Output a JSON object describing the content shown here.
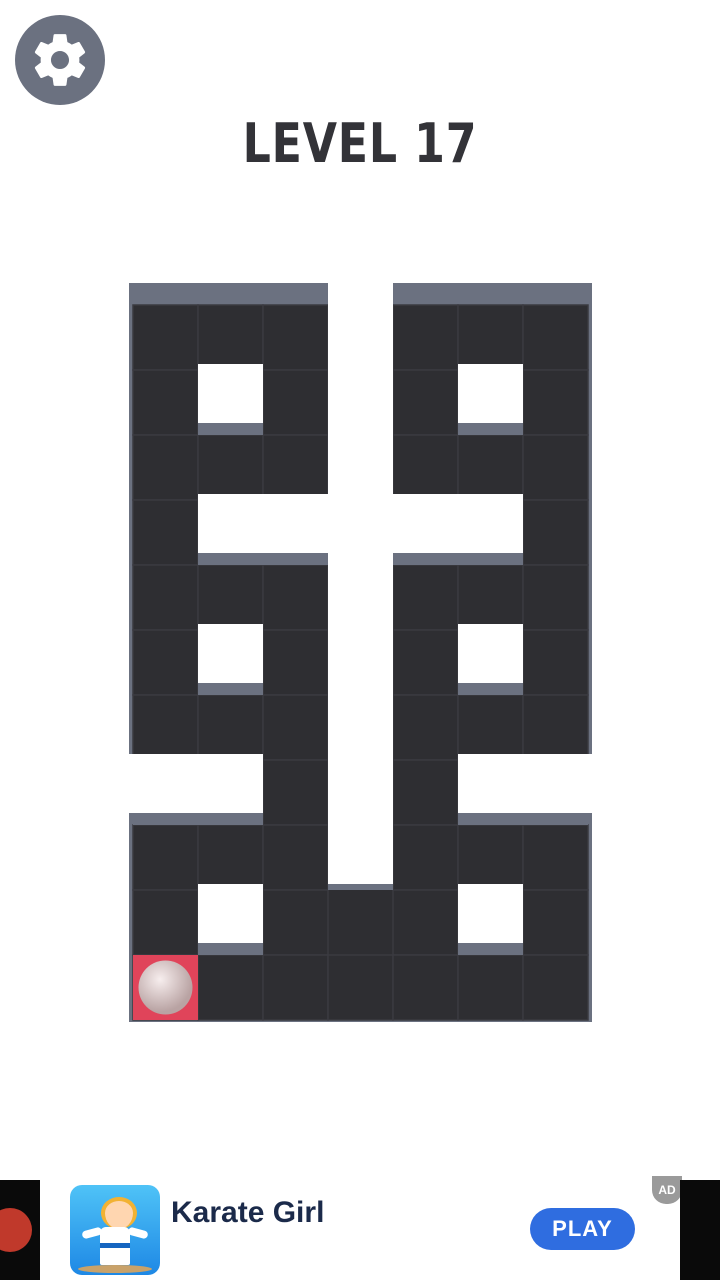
{
  "hud": {
    "level_text": "LEVEL 17",
    "settings_icon": "gear-icon"
  },
  "board": {
    "rows": 11,
    "cols": 7,
    "floor_color": "#2e2e32",
    "wall_color": "#6b7180",
    "visited_color": "#e0445a",
    "ball_color": "#e8d9d9",
    "ball_cell": {
      "row": 10,
      "col": 0
    },
    "visited_cells": [
      [
        10,
        0
      ]
    ],
    "layout": [
      "...#...",
      ".#...#.",
      ".......",
      ".#####.",
      ".......",
      ".#...#.",
      ".......",
      "##...##",
      ".......",
      ".#...#.",
      "......."
    ],
    "inner_void_cells": [
      [
        0,
        3
      ],
      [
        1,
        3
      ],
      [
        3,
        3
      ],
      [
        4,
        3
      ],
      [
        5,
        3
      ],
      [
        6,
        3
      ],
      [
        7,
        3
      ],
      [
        8,
        3
      ],
      [
        9,
        3
      ]
    ]
  },
  "ad": {
    "title": "Karate Girl",
    "cta": "PLAY",
    "badge": "AD",
    "icon": "karate-girl-app-icon"
  }
}
